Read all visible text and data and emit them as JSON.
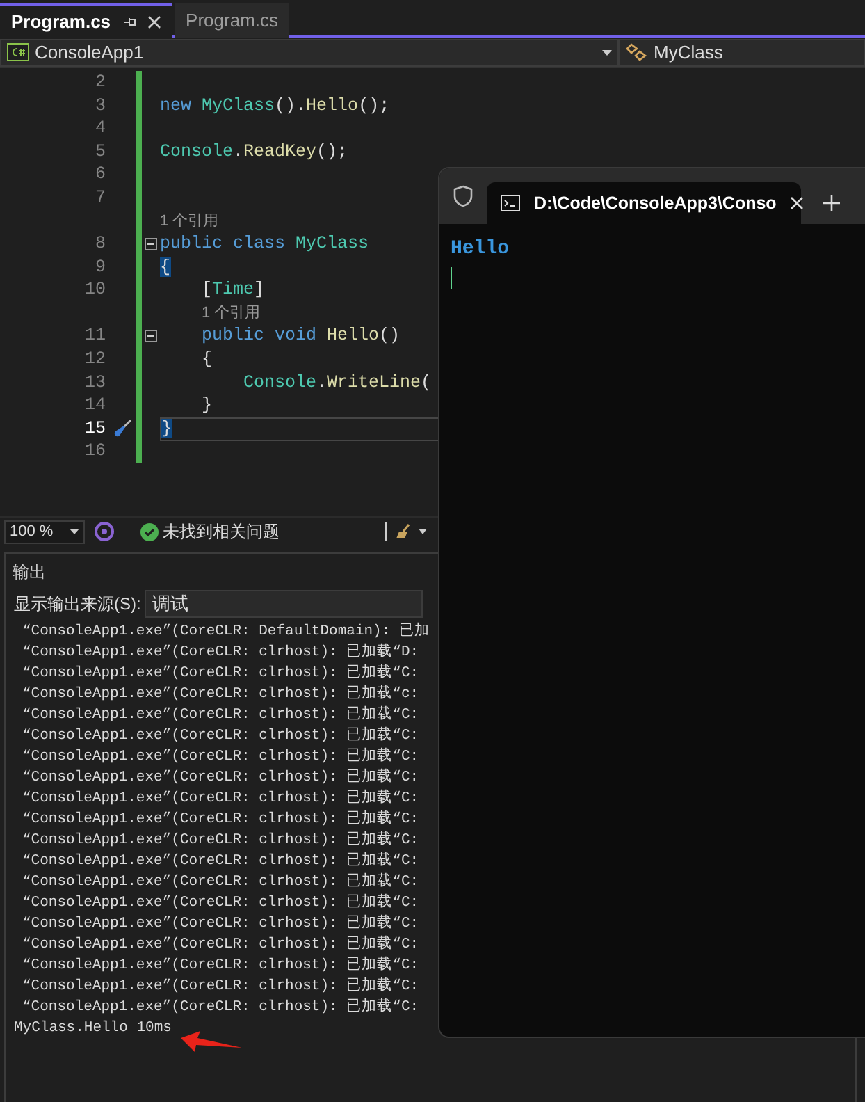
{
  "tabs": [
    {
      "label": "Program.cs",
      "selected": true
    },
    {
      "label": "Program.cs",
      "selected": false
    }
  ],
  "nav_bar": {
    "project": "ConsoleApp1",
    "member": "MyClass"
  },
  "code_lines": [
    {
      "kind": "code",
      "number": "2",
      "modified": true
    },
    {
      "kind": "code",
      "number": "3",
      "modified": true,
      "tokens": [
        {
          "text": "new ",
          "kind": "keyword"
        },
        {
          "text": "MyClass",
          "kind": "type"
        },
        {
          "text": "().",
          "kind": "plain"
        },
        {
          "text": "Hello",
          "kind": "method"
        },
        {
          "text": "();",
          "kind": "plain"
        }
      ]
    },
    {
      "kind": "code",
      "number": "4",
      "modified": true
    },
    {
      "kind": "code",
      "number": "5",
      "modified": true,
      "tokens": [
        {
          "text": "Console",
          "kind": "type"
        },
        {
          "text": ".",
          "kind": "plain"
        },
        {
          "text": "ReadKey",
          "kind": "method"
        },
        {
          "text": "();",
          "kind": "plain"
        }
      ]
    },
    {
      "kind": "code",
      "number": "6",
      "modified": true
    },
    {
      "kind": "code",
      "number": "7",
      "modified": true
    },
    {
      "kind": "lens",
      "modified": true,
      "text": "1 个引用"
    },
    {
      "kind": "code",
      "number": "8",
      "modified": true,
      "foldable": true,
      "tokens": [
        {
          "text": "public class ",
          "kind": "keyword"
        },
        {
          "text": "MyClass",
          "kind": "type"
        }
      ]
    },
    {
      "kind": "code",
      "number": "9",
      "modified": true,
      "tokens": [
        {
          "text": "{",
          "kind": "brace"
        }
      ]
    },
    {
      "kind": "code",
      "number": "10",
      "modified": true,
      "tokens": [
        {
          "text": "    [",
          "kind": "plain"
        },
        {
          "text": "Time",
          "kind": "type"
        },
        {
          "text": "]",
          "kind": "plain"
        }
      ]
    },
    {
      "kind": "lens",
      "modified": true,
      "text": "    1 个引用"
    },
    {
      "kind": "code",
      "number": "11",
      "modified": true,
      "foldable": true,
      "tokens": [
        {
          "text": "    public void ",
          "kind": "keyword"
        },
        {
          "text": "Hello",
          "kind": "method"
        },
        {
          "text": "()",
          "kind": "plain"
        }
      ]
    },
    {
      "kind": "code",
      "number": "12",
      "modified": true,
      "tokens": [
        {
          "text": "    {",
          "kind": "plain"
        }
      ]
    },
    {
      "kind": "code",
      "number": "13",
      "modified": true,
      "tokens": [
        {
          "text": "        Console",
          "kind": "type"
        },
        {
          "text": ".",
          "kind": "plain"
        },
        {
          "text": "WriteLine",
          "kind": "method"
        },
        {
          "text": "(",
          "kind": "plain"
        }
      ]
    },
    {
      "kind": "code",
      "number": "14",
      "modified": true,
      "tokens": [
        {
          "text": "    }",
          "kind": "plain"
        }
      ]
    },
    {
      "kind": "code",
      "number": "15",
      "modified": true,
      "current": true,
      "tokens": [
        {
          "text": "}",
          "kind": "brace"
        }
      ]
    },
    {
      "kind": "code",
      "number": "16",
      "modified": true
    }
  ],
  "status_bar": {
    "zoom": "100 %",
    "issues": "未找到相关问题"
  },
  "output": {
    "title": "输出",
    "source_label": "显示输出来源(S):",
    "source": "调试",
    "lines": [
      "“ConsoleApp1.exe”(CoreCLR: DefaultDomain): 已加",
      "“ConsoleApp1.exe”(CoreCLR: clrhost): 已加载“D:",
      "“ConsoleApp1.exe”(CoreCLR: clrhost): 已加载“C:",
      "“ConsoleApp1.exe”(CoreCLR: clrhost): 已加载“c:",
      "“ConsoleApp1.exe”(CoreCLR: clrhost): 已加载“C:",
      "“ConsoleApp1.exe”(CoreCLR: clrhost): 已加载“C:",
      "“ConsoleApp1.exe”(CoreCLR: clrhost): 已加载“C:",
      "“ConsoleApp1.exe”(CoreCLR: clrhost): 已加载“C:",
      "“ConsoleApp1.exe”(CoreCLR: clrhost): 已加载“C:",
      "“ConsoleApp1.exe”(CoreCLR: clrhost): 已加载“C:",
      "“ConsoleApp1.exe”(CoreCLR: clrhost): 已加载“C:",
      "“ConsoleApp1.exe”(CoreCLR: clrhost): 已加载“C:",
      "“ConsoleApp1.exe”(CoreCLR: clrhost): 已加载“C:",
      "“ConsoleApp1.exe”(CoreCLR: clrhost): 已加载“C:",
      "“ConsoleApp1.exe”(CoreCLR: clrhost): 已加载“C:",
      "“ConsoleApp1.exe”(CoreCLR: clrhost): 已加载“C:",
      "“ConsoleApp1.exe”(CoreCLR: clrhost): 已加载“C:",
      "“ConsoleApp1.exe”(CoreCLR: clrhost): 已加载“C:",
      "“ConsoleApp1.exe”(CoreCLR: clrhost): 已加载“C:",
      "MyClass.Hello 10ms"
    ],
    "arrow": true
  },
  "console": {
    "tab_title": "D:\\Code\\ConsoleApp3\\Conso",
    "lines": [
      "Hello"
    ],
    "cursor": true
  }
}
